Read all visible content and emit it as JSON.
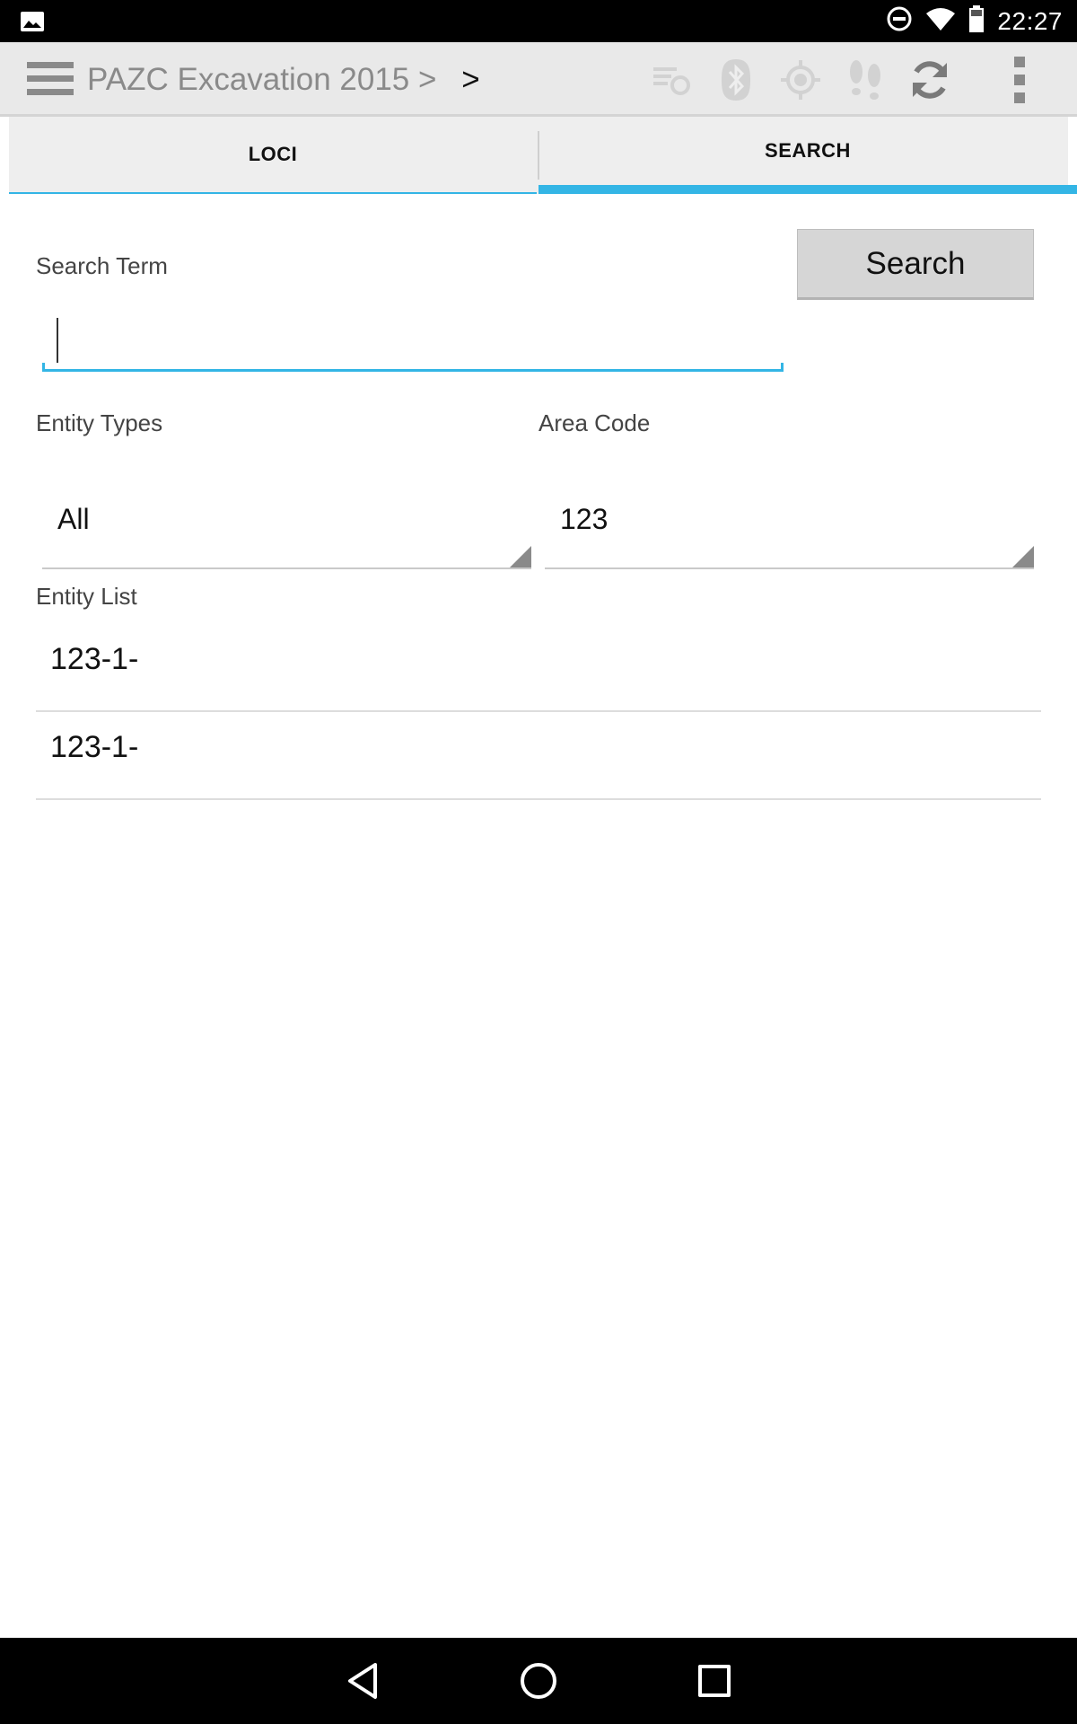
{
  "status_bar": {
    "time": "22:27",
    "icons": [
      "image-icon",
      "do-not-disturb-icon",
      "wifi-icon",
      "battery-icon"
    ]
  },
  "action_bar": {
    "title": "PAZC Excavation 2015",
    "separator": ">",
    "crumb2": ">",
    "icons": [
      "menu-icon",
      "sync-status-icon",
      "bluetooth-icon",
      "gps-icon",
      "tracking-icon",
      "refresh-icon",
      "overflow-menu-icon"
    ]
  },
  "tabs": [
    {
      "label": "LOCI",
      "selected": false
    },
    {
      "label": "SEARCH",
      "selected": true
    }
  ],
  "search": {
    "term_label": "Search Term",
    "term_value": "",
    "button_label": "Search"
  },
  "filters": {
    "entity_types_label": "Entity Types",
    "entity_types_value": "All",
    "area_code_label": "Area Code",
    "area_code_value": "123"
  },
  "entity_list": {
    "label": "Entity List",
    "items": [
      "123-1-",
      "123-1-"
    ]
  },
  "colors": {
    "accent": "#33b5e5",
    "action_bar_bg": "#e9e9e9",
    "tab_bg": "#eeeeee"
  }
}
